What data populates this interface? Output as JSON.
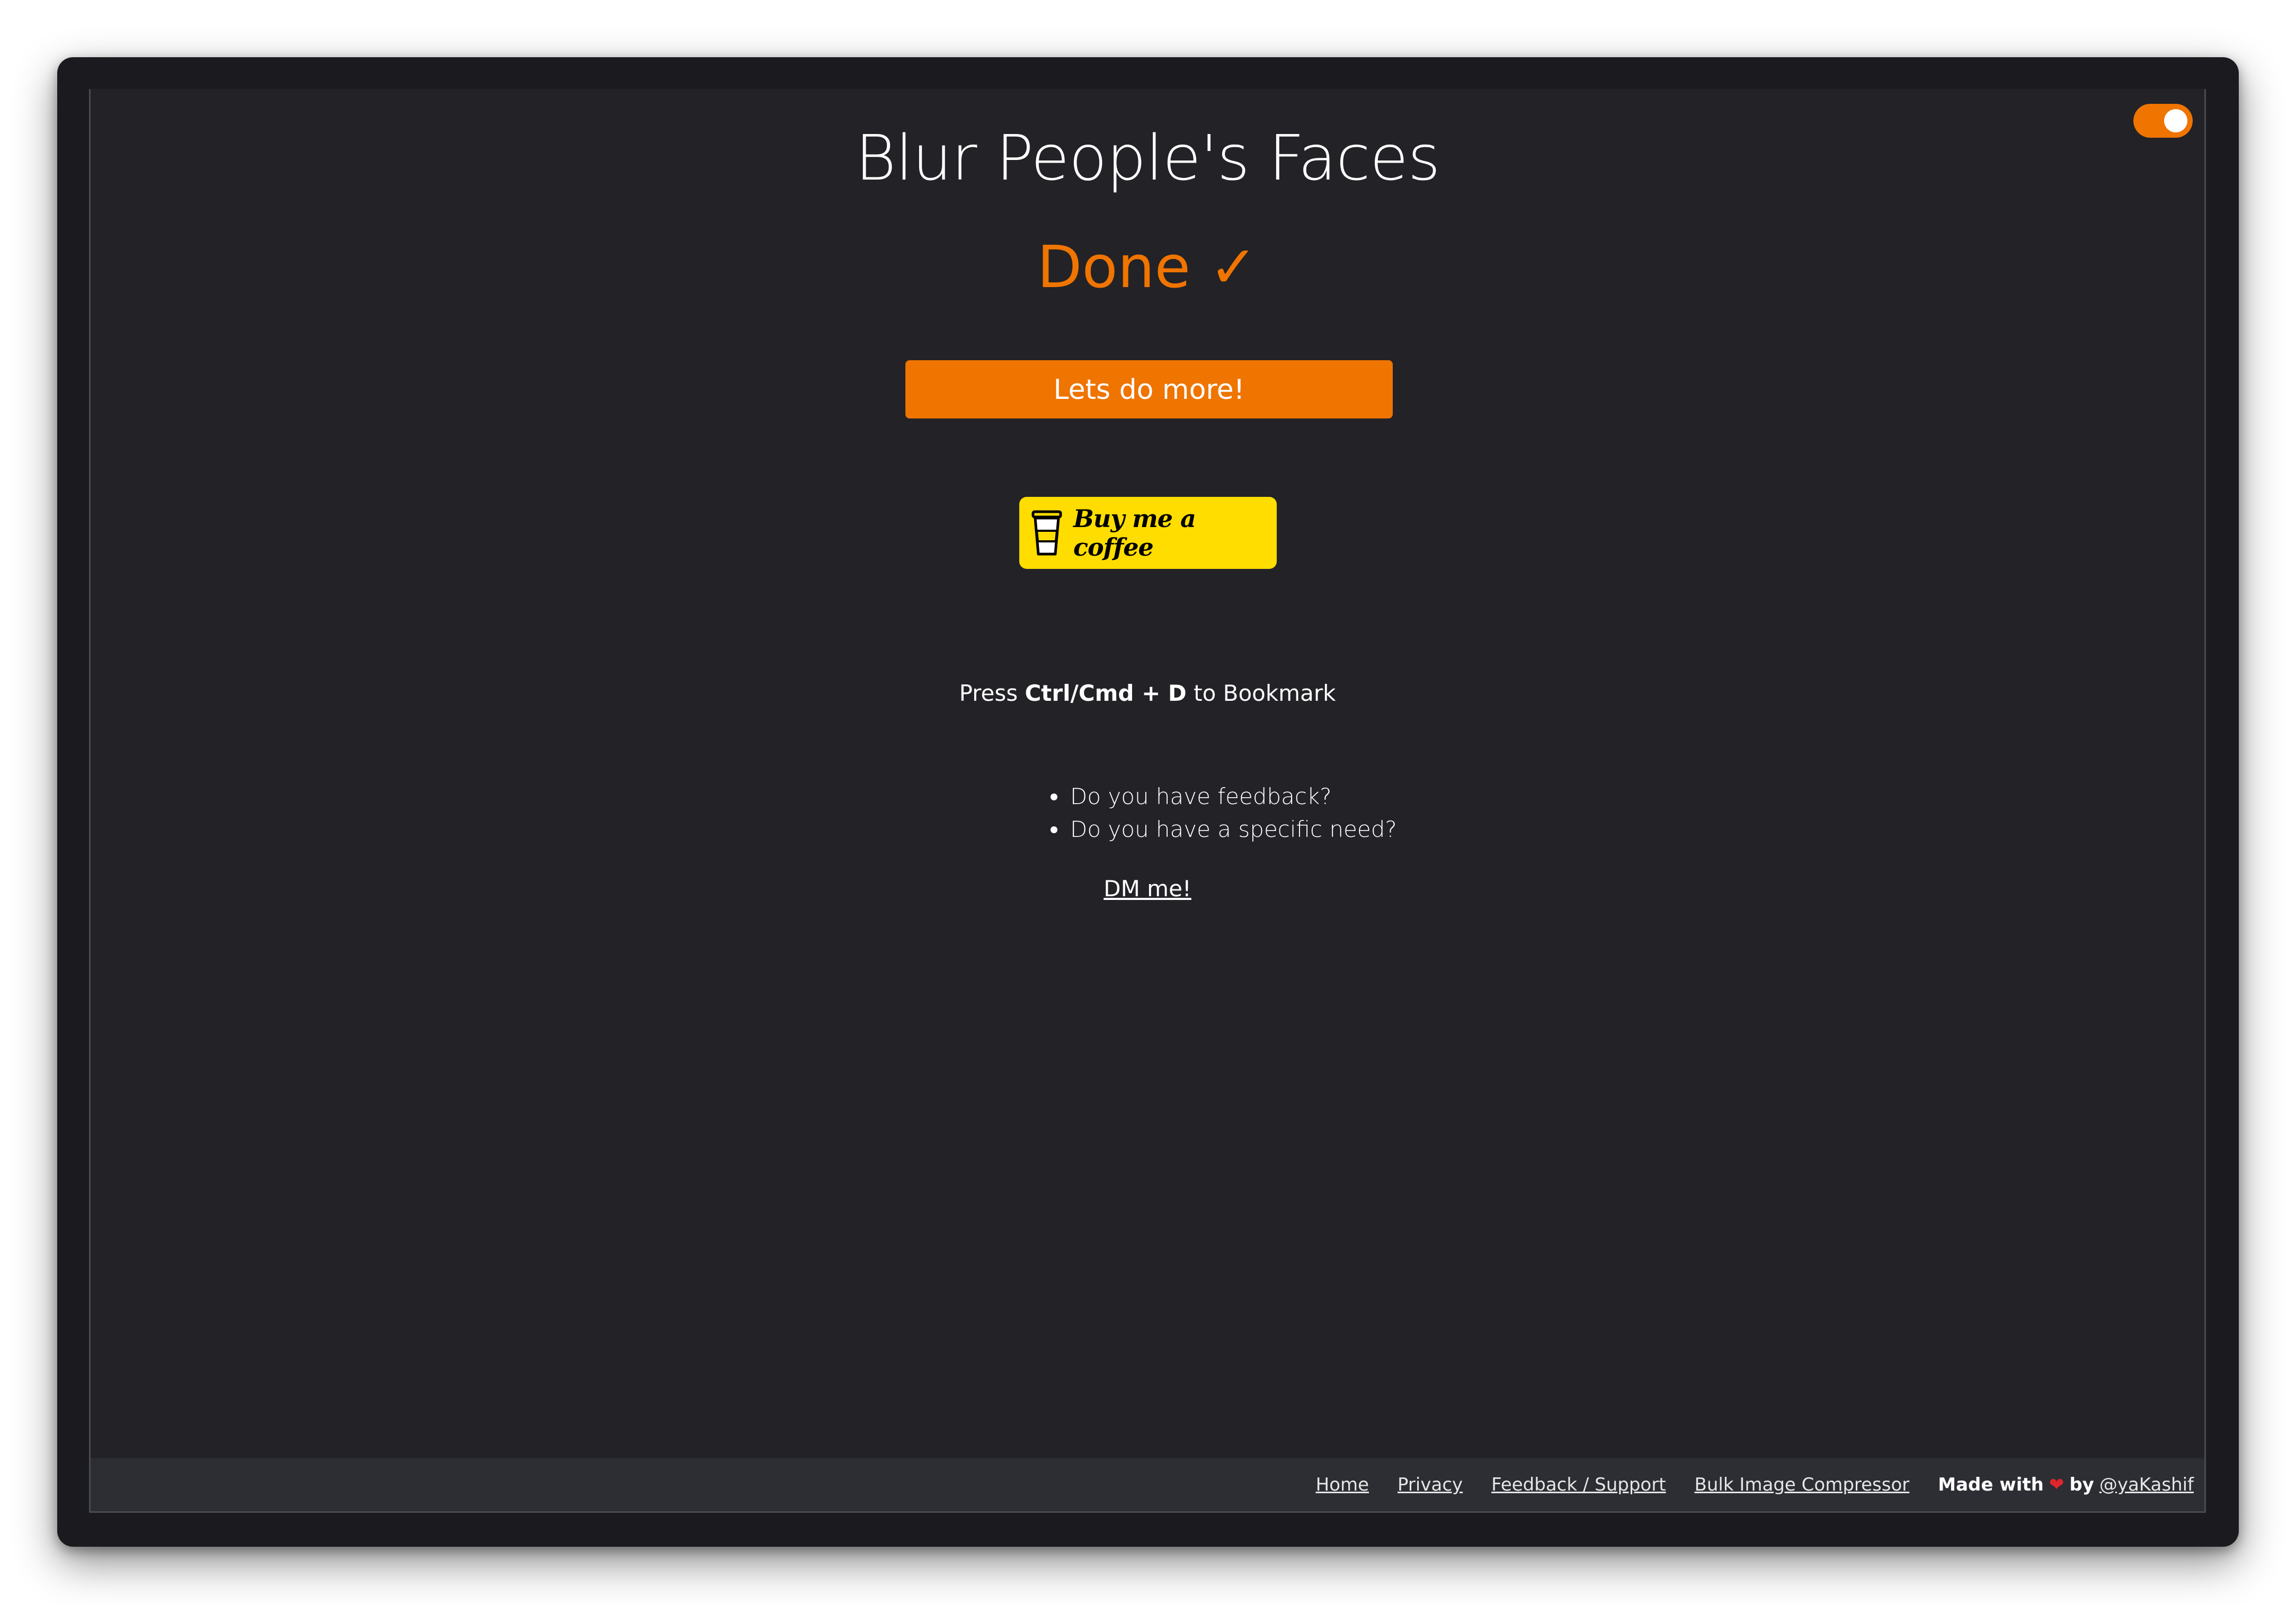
{
  "header": {
    "title": "Blur People's Faces",
    "status": "Done ✓"
  },
  "actions": {
    "primary_label": "Lets do more!",
    "coffee_label": "Buy me a coffee"
  },
  "bookmark": {
    "prefix": "Press",
    "shortcut": "Ctrl/Cmd + D",
    "suffix": "to Bookmark"
  },
  "feedback": {
    "items": [
      "Do you have feedback?",
      "Do you have a specific need?"
    ],
    "dm_label": "DM me!"
  },
  "footer": {
    "links": [
      "Home",
      "Privacy",
      "Feedback / Support",
      "Bulk Image Compressor"
    ],
    "made_with_prefix": "Made with",
    "made_with_by": "by",
    "author": "@yaKashif"
  },
  "theme": {
    "accent": "#ef7400",
    "coffee_yellow": "#ffdd00",
    "background": "#222227",
    "dark_mode_toggle": "on"
  }
}
